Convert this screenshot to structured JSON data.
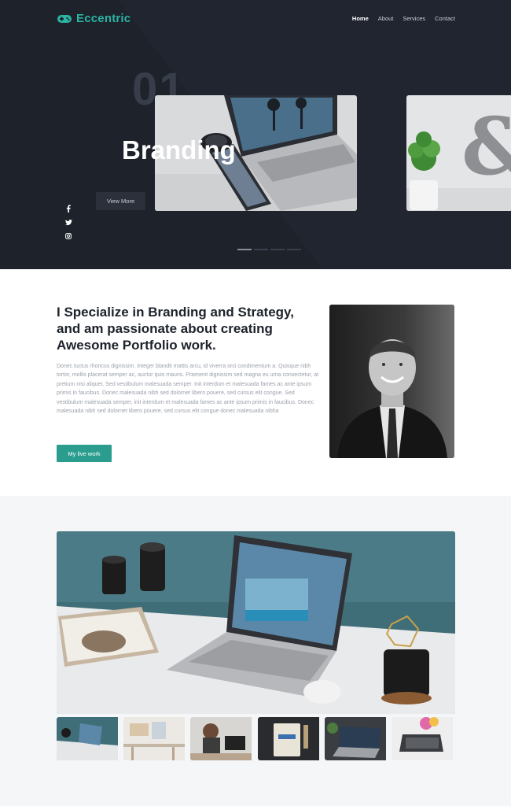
{
  "nav": {
    "brand": "Eccentric",
    "links": [
      {
        "label": "Home",
        "active": true
      },
      {
        "label": "About",
        "active": false
      },
      {
        "label": "Services",
        "active": false
      },
      {
        "label": "Contact",
        "active": false
      }
    ]
  },
  "hero": {
    "number": "01",
    "title": "Branding",
    "button": "View More",
    "social_icons": [
      "facebook-icon",
      "twitter-icon",
      "instagram-icon"
    ],
    "slide_count": 4,
    "active_slide": 0
  },
  "about": {
    "title": "I Specialize in Branding and Strategy, and am passionate about creating Awesome Portfolio work.",
    "body": "Donec luctus rhoncus dignissim. Integer blandit mattis arcu, id viverra orci condimentum a. Quisque nibh tortor, mollis placerat semper ac, auctor quis mauris. Praesent dignissim sed magna eu urna consectetur, at pretium nisi aliquet. Sed vestibulum malesuada semper. Init interdum et malesuada fames ac ante ipsum primis in faucibus. Donec malesuada nibh sed dolornet libero pouere, sed cursus elit congue. Sed vestibulum malesuada semper, init interdum et malesuada fames ac ante ipsum primis in faucibus. Donec malesuada nibh sed dolornet libero pouere, sed cursus elit congue donec malesuada nibha",
    "button": "My live work"
  },
  "gallery": {
    "thumb_count": 6
  },
  "colors": {
    "accent": "#2a9d8f",
    "brand": "#2bb3a3",
    "hero_bg": "#1d222b"
  }
}
